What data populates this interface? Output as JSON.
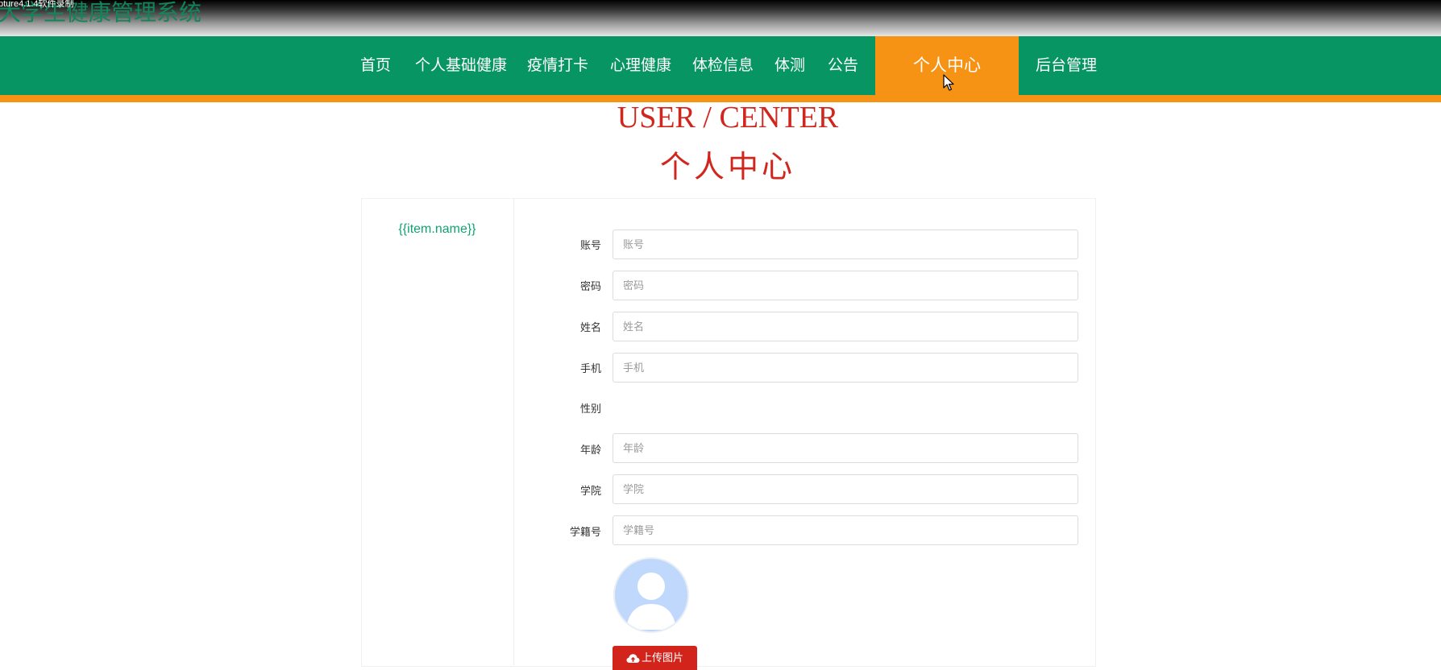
{
  "window": {
    "capture_text": "pture4.1.4软件录制"
  },
  "site": {
    "title": "大学生健康管理系统"
  },
  "nav": {
    "items": [
      "首页",
      "个人基础健康",
      "疫情打卡",
      "心理健康",
      "体检信息",
      "体测",
      "公告"
    ],
    "active": "个人中心",
    "admin": "后台管理"
  },
  "colors": {
    "nav_green": "#089564",
    "accent_orange": "#f79314",
    "heading_red": "#d0261d",
    "link_green": "#10a36f",
    "upload_red": "#d3241c"
  },
  "page": {
    "heading_en": "USER / CENTER",
    "heading_cn": "个人中心"
  },
  "sidebar": {
    "item": "{{item.name}}"
  },
  "form": {
    "account": {
      "label": "账号",
      "placeholder": "账号",
      "value": ""
    },
    "password": {
      "label": "密码",
      "placeholder": "密码",
      "value": ""
    },
    "name": {
      "label": "姓名",
      "placeholder": "姓名",
      "value": ""
    },
    "phone": {
      "label": "手机",
      "placeholder": "手机",
      "value": ""
    },
    "gender": {
      "label": "性别"
    },
    "age": {
      "label": "年龄",
      "placeholder": "年龄",
      "value": ""
    },
    "college": {
      "label": "学院",
      "placeholder": "学院",
      "value": ""
    },
    "student_id": {
      "label": "学籍号",
      "placeholder": "学籍号",
      "value": ""
    },
    "upload_label": "上传图片"
  },
  "icons": {
    "cursor": "mouse-pointer-icon",
    "upload": "cloud-upload-icon",
    "avatar": "default-avatar-icon"
  }
}
